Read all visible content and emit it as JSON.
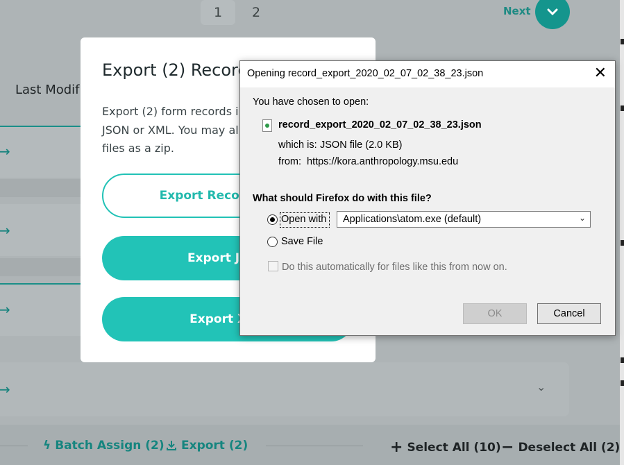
{
  "pagination": {
    "pages": [
      "1",
      "2"
    ],
    "next_label": "Next"
  },
  "background": {
    "last_modified_label": "Last Modif"
  },
  "export_modal": {
    "title": "Export (2) Records",
    "description_lines": [
      "Export (2) form records in",
      "JSON or XML. You may al",
      "files as a zip."
    ],
    "buttons": [
      "Export Records Files",
      "Export JSON",
      "Export XML"
    ]
  },
  "bottom_bar": {
    "batch_assign": "Batch Assign (2)",
    "export": "Export (2)",
    "select_all": "Select All (10)",
    "deselect_all": "Deselect All (2)"
  },
  "dialog": {
    "title": "Opening record_export_2020_02_07_02_38_23.json",
    "intro": "You have chosen to open:",
    "filename": "record_export_2020_02_07_02_38_23.json",
    "which_is_label": "which is:",
    "which_is_value": "JSON file (2.0 KB)",
    "from_label": "from:",
    "from_value": "https://kora.anthropology.msu.edu",
    "question": "What should Firefox do with this file?",
    "open_with_label": "Open with",
    "open_with_app": "Applications\\atom.exe (default)",
    "save_file_label": "Save File",
    "auto_label": "Do this automatically for files like this from now on.",
    "ok_label": "OK",
    "cancel_label": "Cancel"
  },
  "colors": {
    "teal": "#22c3b7",
    "teal_dark": "#14958d",
    "overlay": "#aeb4b6"
  }
}
